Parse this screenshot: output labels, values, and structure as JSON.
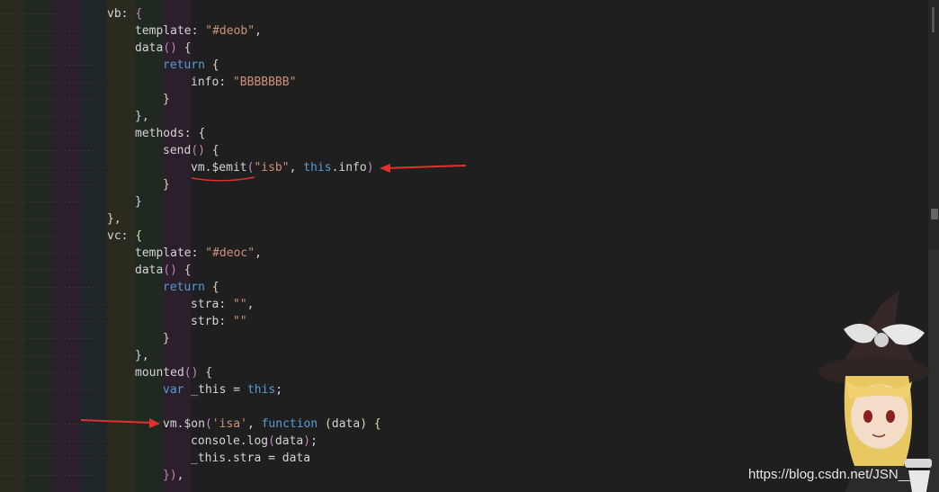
{
  "editor": {
    "lines": [
      {
        "indent": 4,
        "tokens": [
          {
            "t": "vb",
            "c": "n"
          },
          {
            "t": ": ",
            "c": "n"
          },
          {
            "t": "{",
            "c": "p"
          }
        ]
      },
      {
        "indent": 5,
        "tokens": [
          {
            "t": "template",
            "c": "n"
          },
          {
            "t": ": ",
            "c": "n"
          },
          {
            "t": "\"#deob\"",
            "c": "s"
          },
          {
            "t": ",",
            "c": "n"
          }
        ]
      },
      {
        "indent": 5,
        "tokens": [
          {
            "t": "data",
            "c": "n"
          },
          {
            "t": "()",
            "c": "p"
          },
          {
            "t": " {",
            "c": "n"
          }
        ]
      },
      {
        "indent": 6,
        "tokens": [
          {
            "t": "return",
            "c": "k"
          },
          {
            "t": " {",
            "c": "f"
          }
        ]
      },
      {
        "indent": 7,
        "tokens": [
          {
            "t": "info",
            "c": "n"
          },
          {
            "t": ": ",
            "c": "n"
          },
          {
            "t": "\"BBBBBBB\"",
            "c": "s"
          }
        ]
      },
      {
        "indent": 6,
        "tokens": [
          {
            "t": "}",
            "c": "f"
          }
        ]
      },
      {
        "indent": 5,
        "tokens": [
          {
            "t": "},",
            "c": "n"
          }
        ]
      },
      {
        "indent": 5,
        "tokens": [
          {
            "t": "methods",
            "c": "n"
          },
          {
            "t": ": {",
            "c": "n"
          }
        ]
      },
      {
        "indent": 6,
        "tokens": [
          {
            "t": "send",
            "c": "n"
          },
          {
            "t": "()",
            "c": "p"
          },
          {
            "t": " {",
            "c": "n"
          }
        ]
      },
      {
        "indent": 7,
        "tokens": [
          {
            "t": "vm.$emit",
            "c": "n"
          },
          {
            "t": "(",
            "c": "p"
          },
          {
            "t": "\"isb\"",
            "c": "s"
          },
          {
            "t": ", ",
            "c": "n"
          },
          {
            "t": "this",
            "c": "k"
          },
          {
            "t": ".info",
            "c": "n"
          },
          {
            "t": ")",
            "c": "p"
          }
        ]
      },
      {
        "indent": 6,
        "tokens": [
          {
            "t": "}",
            "c": "f"
          }
        ]
      },
      {
        "indent": 5,
        "tokens": [
          {
            "t": "}",
            "c": "n"
          }
        ]
      },
      {
        "indent": 4,
        "tokens": [
          {
            "t": "},",
            "c": "f"
          }
        ]
      },
      {
        "indent": 4,
        "tokens": [
          {
            "t": "vc",
            "c": "n"
          },
          {
            "t": ": ",
            "c": "n"
          },
          {
            "t": "{",
            "c": "f"
          }
        ]
      },
      {
        "indent": 5,
        "tokens": [
          {
            "t": "template",
            "c": "n"
          },
          {
            "t": ": ",
            "c": "n"
          },
          {
            "t": "\"#deoc\"",
            "c": "s"
          },
          {
            "t": ",",
            "c": "n"
          }
        ]
      },
      {
        "indent": 5,
        "tokens": [
          {
            "t": "data",
            "c": "n"
          },
          {
            "t": "()",
            "c": "p"
          },
          {
            "t": " {",
            "c": "n"
          }
        ]
      },
      {
        "indent": 6,
        "tokens": [
          {
            "t": "return",
            "c": "k"
          },
          {
            "t": " {",
            "c": "f"
          }
        ]
      },
      {
        "indent": 7,
        "tokens": [
          {
            "t": "stra",
            "c": "n"
          },
          {
            "t": ": ",
            "c": "n"
          },
          {
            "t": "\"\"",
            "c": "s"
          },
          {
            "t": ",",
            "c": "n"
          }
        ]
      },
      {
        "indent": 7,
        "tokens": [
          {
            "t": "strb",
            "c": "n"
          },
          {
            "t": ": ",
            "c": "n"
          },
          {
            "t": "\"\"",
            "c": "s"
          }
        ]
      },
      {
        "indent": 6,
        "tokens": [
          {
            "t": "}",
            "c": "f"
          }
        ]
      },
      {
        "indent": 5,
        "tokens": [
          {
            "t": "},",
            "c": "n"
          }
        ]
      },
      {
        "indent": 5,
        "tokens": [
          {
            "t": "mounted",
            "c": "n"
          },
          {
            "t": "()",
            "c": "p"
          },
          {
            "t": " {",
            "c": "n"
          }
        ]
      },
      {
        "indent": 6,
        "tokens": [
          {
            "t": "var",
            "c": "k"
          },
          {
            "t": " _this = ",
            "c": "n"
          },
          {
            "t": "this",
            "c": "k"
          },
          {
            "t": ";",
            "c": "n"
          }
        ]
      },
      {
        "indent": 0,
        "tokens": []
      },
      {
        "indent": 6,
        "tokens": [
          {
            "t": "vm.$on",
            "c": "n"
          },
          {
            "t": "(",
            "c": "p"
          },
          {
            "t": "'isa'",
            "c": "s"
          },
          {
            "t": ", ",
            "c": "n"
          },
          {
            "t": "function",
            "c": "k"
          },
          {
            "t": " (",
            "c": "f"
          },
          {
            "t": "data",
            "c": "n"
          },
          {
            "t": ")",
            "c": "f"
          },
          {
            "t": " {",
            "c": "f"
          }
        ]
      },
      {
        "indent": 7,
        "tokens": [
          {
            "t": "console.log",
            "c": "n"
          },
          {
            "t": "(",
            "c": "p"
          },
          {
            "t": "data",
            "c": "n"
          },
          {
            "t": ")",
            "c": "p"
          },
          {
            "t": ";",
            "c": "n"
          }
        ]
      },
      {
        "indent": 7,
        "tokens": [
          {
            "t": "_this.stra = data",
            "c": "n"
          }
        ]
      },
      {
        "indent": 6,
        "tokens": [
          {
            "t": "})",
            "c": "p"
          },
          {
            "t": ",",
            "c": "n"
          }
        ]
      }
    ]
  },
  "colors": {
    "keyword": "#569cd6",
    "string": "#ce9178",
    "paren": "#c586c0",
    "brace": "#dcdcaa",
    "annotation": "#e03030"
  },
  "watermark": "https://blog.csdn.net/JSN___",
  "mascot_icon": "witch-girl-illustration"
}
